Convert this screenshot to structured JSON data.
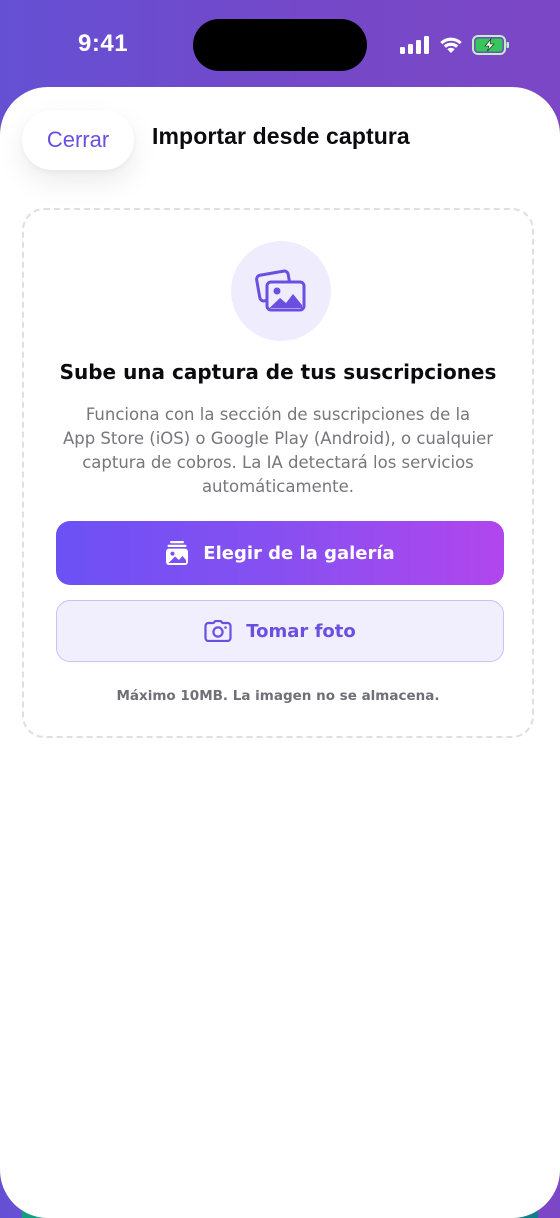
{
  "status_bar": {
    "time": "9:41",
    "icons": [
      "signal-icon",
      "wifi-icon",
      "battery-charging-icon"
    ]
  },
  "sheet": {
    "close_label": "Cerrar",
    "title": "Importar desde captura"
  },
  "upload": {
    "icon": "images-icon",
    "heading": "Sube una captura de tus suscripciones",
    "description_lines": [
      "Funciona con la sección de suscripciones de la",
      "App Store (iOS) o Google Play (Android), o cualquier",
      "captura de cobros. La IA detectará los servicios",
      "automáticamente."
    ],
    "gallery_button": {
      "label": "Elegir de la galería",
      "icon": "gallery-icon"
    },
    "photo_button": {
      "label": "Tomar foto",
      "icon": "camera-icon"
    },
    "note": "Máximo 10MB. La imagen no se almacena."
  },
  "colors": {
    "header_gradient_start": "#6550D4",
    "header_gradient_end": "#7C47C6",
    "accent": "#6a4fe0",
    "button_gradient_start": "#6b51f5",
    "button_gradient_end": "#b146ee",
    "secondary_button_bg": "#f1effd"
  }
}
